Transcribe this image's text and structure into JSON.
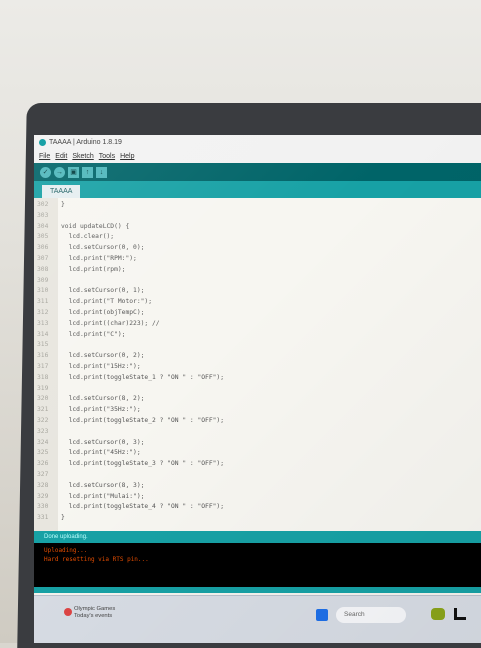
{
  "window": {
    "title": "TAAAA | Arduino 1.8.19"
  },
  "menu": [
    "File",
    "Edit",
    "Sketch",
    "Tools",
    "Help"
  ],
  "toolbar": {
    "buttons": [
      "verify-icon",
      "upload-icon",
      "new-icon",
      "open-icon",
      "save-icon"
    ]
  },
  "tabs": [
    {
      "label": "TAAAA"
    }
  ],
  "editor": {
    "lines": [
      {
        "n": "302",
        "text": "}"
      },
      {
        "n": "303",
        "text": ""
      },
      {
        "n": "304",
        "text": "void updateLCD() {"
      },
      {
        "n": "305",
        "text": "  lcd.clear();"
      },
      {
        "n": "306",
        "text": "  lcd.setCursor(0, 0);"
      },
      {
        "n": "307",
        "text": "  lcd.print(\"RPM:\");"
      },
      {
        "n": "308",
        "text": "  lcd.print(rpm);"
      },
      {
        "n": "309",
        "text": ""
      },
      {
        "n": "310",
        "text": "  lcd.setCursor(0, 1);"
      },
      {
        "n": "311",
        "text": "  lcd.print(\"T Motor:\");"
      },
      {
        "n": "312",
        "text": "  lcd.print(objTempC);"
      },
      {
        "n": "313",
        "text": "  lcd.print((char)223); //"
      },
      {
        "n": "314",
        "text": "  lcd.print(\"C\");"
      },
      {
        "n": "315",
        "text": ""
      },
      {
        "n": "316",
        "text": "  lcd.setCursor(0, 2);"
      },
      {
        "n": "317",
        "text": "  lcd.print(\"15Hz:\");"
      },
      {
        "n": "318",
        "text": "  lcd.print(toggleState_1 ? \"ON \" : \"OFF\");"
      },
      {
        "n": "319",
        "text": ""
      },
      {
        "n": "320",
        "text": "  lcd.setCursor(8, 2);"
      },
      {
        "n": "321",
        "text": "  lcd.print(\"35Hz:\");"
      },
      {
        "n": "322",
        "text": "  lcd.print(toggleState_2 ? \"ON \" : \"OFF\");"
      },
      {
        "n": "323",
        "text": ""
      },
      {
        "n": "324",
        "text": "  lcd.setCursor(0, 3);"
      },
      {
        "n": "325",
        "text": "  lcd.print(\"45Hz:\");"
      },
      {
        "n": "326",
        "text": "  lcd.print(toggleState_3 ? \"ON \" : \"OFF\");"
      },
      {
        "n": "327",
        "text": ""
      },
      {
        "n": "328",
        "text": "  lcd.setCursor(8, 3);"
      },
      {
        "n": "329",
        "text": "  lcd.print(\"Mulai:\");"
      },
      {
        "n": "330",
        "text": "  lcd.print(toggleState_4 ? \"ON \" : \"OFF\");"
      },
      {
        "n": "331",
        "text": "}"
      }
    ]
  },
  "status": {
    "text": "Done uploading."
  },
  "console": {
    "lines": [
      "Uploading...",
      "Hard resetting via RTS pin..."
    ]
  },
  "taskbar": {
    "weather_line1": "Olympic Games",
    "weather_line2": "Today's events",
    "search_placeholder": "Search"
  },
  "colors": {
    "toolbar": "#006468",
    "tabbar": "#17a1a5",
    "editor_bg": "#f7f6f1",
    "console_bg": "#000000",
    "error_text": "#e34c00"
  }
}
